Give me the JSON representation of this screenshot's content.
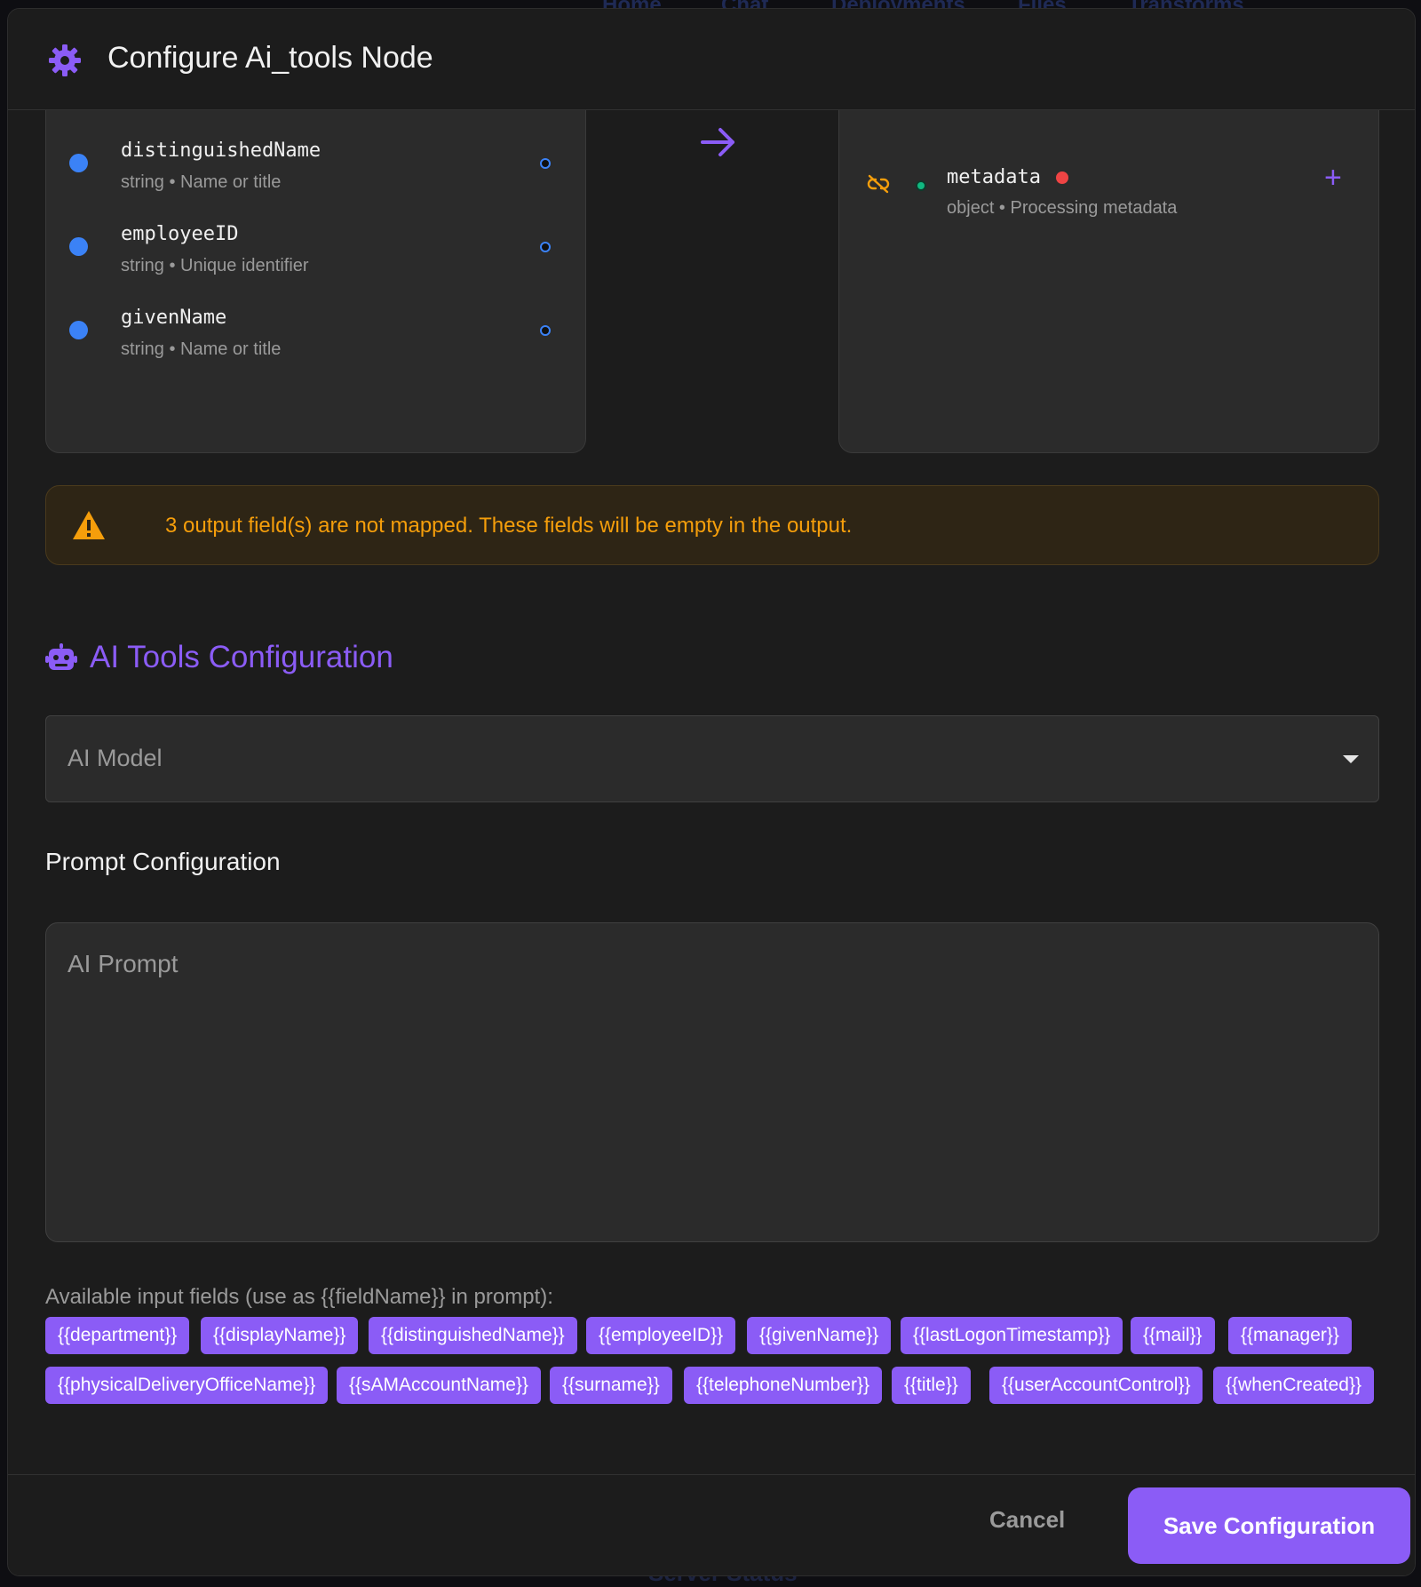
{
  "background_nav": [
    "Home",
    "Chat",
    "Deployments",
    "Files",
    "Transforms"
  ],
  "background_bottom": "Server Status",
  "modal": {
    "title": "Configure Ai_tools Node",
    "input_fields": [
      {
        "name": "distinguishedName",
        "desc": "string • Name or title"
      },
      {
        "name": "employeeID",
        "desc": "string • Unique identifier"
      },
      {
        "name": "givenName",
        "desc": "string • Name or title"
      }
    ],
    "output_fields": [
      {
        "name": "metadata",
        "desc": "object • Processing metadata"
      }
    ],
    "warning": "3 output field(s) are not mapped. These fields will be empty in the output.",
    "section_title": "AI Tools Configuration",
    "model_select": {
      "placeholder": "AI Model"
    },
    "prompt_label": "Prompt Configuration",
    "prompt_textarea": {
      "placeholder": "AI Prompt"
    },
    "available_label": "Available input fields (use as {{fieldName}} in prompt):",
    "available_fields": [
      "{{department}}",
      "{{displayName}}",
      "{{distinguishedName}}",
      "{{employeeID}}",
      "{{givenName}}",
      "{{lastLogonTimestamp}}",
      "{{mail}}",
      "{{manager}}",
      "{{physicalDeliveryOfficeName}}",
      "{{sAMAccountName}}",
      "{{surname}}",
      "{{telephoneNumber}}",
      "{{title}}",
      "{{userAccountControl}}",
      "{{whenCreated}}"
    ],
    "cancel_label": "Cancel",
    "save_label": "Save Configuration"
  },
  "colors": {
    "accent": "#8b5cf6",
    "input_dot": "#3b82f6",
    "mapped_dot": "#10b981",
    "required_dot": "#ef4444",
    "warning": "#f59e0b",
    "modal_bg": "#1c1c1c"
  },
  "icons": {
    "header": "gear-icon",
    "arrow": "arrow-right-icon",
    "unlink": "unlink-icon",
    "add": "plus-icon",
    "warning": "warning-triangle-icon",
    "section": "robot-icon",
    "select": "caret-down-icon"
  }
}
